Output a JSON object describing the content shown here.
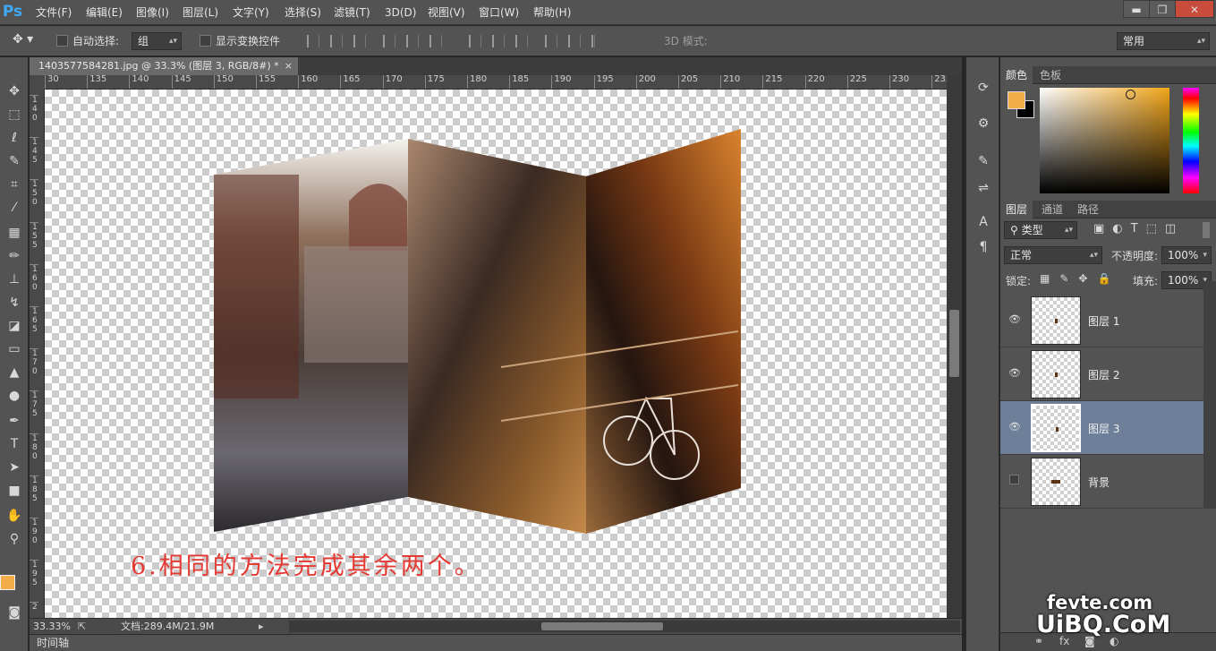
{
  "app": {
    "logo": "Ps"
  },
  "menu": [
    "文件(F)",
    "编辑(E)",
    "图像(I)",
    "图层(L)",
    "文字(Y)",
    "选择(S)",
    "滤镜(T)",
    "3D(D)",
    "视图(V)",
    "窗口(W)",
    "帮助(H)"
  ],
  "window_controls": {
    "minimize": "▬",
    "restore": "❐",
    "close": "✕"
  },
  "options": {
    "tool_icon": "move-icon",
    "auto_select_label": "自动选择:",
    "auto_select_value": "组",
    "show_transform_label": "显示变换控件",
    "mode_3d_label": "3D 模式:",
    "workspace_value": "常用"
  },
  "document": {
    "tab_title": "1403577584281.jpg @ 33.3% (图层 3, RGB/8#) *",
    "close_glyph": "×"
  },
  "ruler": {
    "h_ticks": [
      "30",
      "135",
      "140",
      "145",
      "150",
      "155",
      "160",
      "165",
      "170",
      "175",
      "180",
      "185",
      "190",
      "195",
      "200",
      "205",
      "210",
      "215",
      "220",
      "225",
      "230",
      "235"
    ],
    "v_ticks": [
      "140",
      "145",
      "150",
      "155",
      "160",
      "165",
      "170",
      "175",
      "180",
      "185",
      "190",
      "195",
      "2"
    ]
  },
  "canvas": {
    "caption": "6.相同的方法完成其余两个。"
  },
  "status": {
    "zoom": "33.33%",
    "doc_info": "文档:289.4M/21.9M"
  },
  "timeline_label": "时间轴",
  "color_panel": {
    "tabs": [
      "颜色",
      "色板"
    ],
    "foreground": "#f3ae49",
    "background": "#000000"
  },
  "layers_panel": {
    "tabs": [
      "图层",
      "通道",
      "路径"
    ],
    "filter_value": "类型",
    "blend_value": "正常",
    "opacity_label": "不透明度:",
    "opacity_value": "100%",
    "lock_label": "锁定:",
    "fill_label": "填充:",
    "fill_value": "100%",
    "layers": [
      {
        "name": "图层 1",
        "visible": true,
        "selected": false
      },
      {
        "name": "图层 2",
        "visible": true,
        "selected": false
      },
      {
        "name": "图层 3",
        "visible": true,
        "selected": true
      },
      {
        "name": "背景",
        "visible": false,
        "selected": false
      }
    ]
  },
  "watermark": {
    "line1": "fevte.com",
    "line2": "UiBQ.CoM"
  }
}
